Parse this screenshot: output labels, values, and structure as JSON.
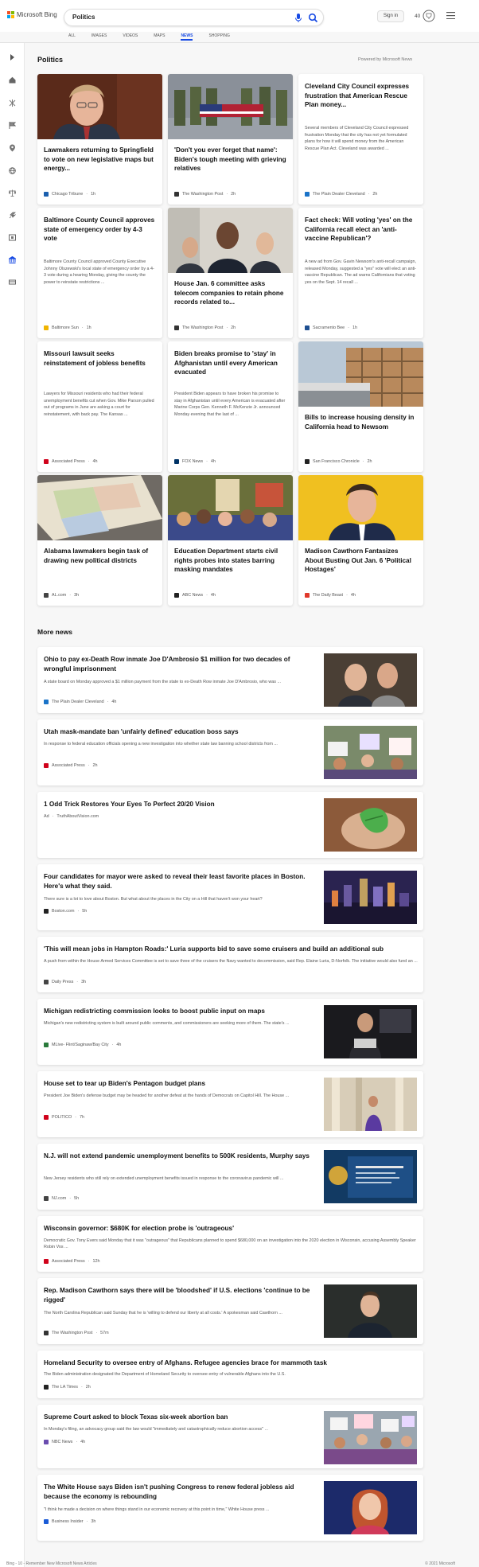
{
  "header": {
    "logo_text": "Microsoft Bing",
    "search_value": "Politics",
    "signin_label": "Sign in",
    "points": "40"
  },
  "tabs": [
    {
      "label": "ALL"
    },
    {
      "label": "IMAGES"
    },
    {
      "label": "VIDEOS"
    },
    {
      "label": "MAPS"
    },
    {
      "label": "NEWS",
      "active": true
    },
    {
      "label": "SHOPPING"
    }
  ],
  "section": {
    "title": "Politics",
    "powered": "Powered by Microsoft News"
  },
  "cards": [
    {
      "title": "Lawmakers returning to Springfield to vote on new legislative maps but energy...",
      "snippet": "",
      "source": "Chicago Tribune",
      "time": "1h",
      "logo_color": "#1b5fae"
    },
    {
      "title": "'Don't you ever forget that name': Biden's tough meeting with grieving relatives",
      "snippet": "",
      "source": "The Washington Post",
      "time": "2h",
      "logo_color": "#333333"
    },
    {
      "title": "Cleveland City Council expresses frustration that American Rescue Plan money...",
      "snippet": "Several members of Cleveland City Council expressed frustration Monday that the city has not yet formulated plans for how it will spend money from the American Rescue Plan Act. Cleveland was awarded ...",
      "source": "The Plain Dealer Cleveland",
      "time": "2h",
      "logo_color": "#1a73c8"
    },
    {
      "title": "Baltimore County Council approves state of emergency order by 4-3 vote",
      "snippet": "Baltimore County Council approved County Executive Johnny Olszewski's local state of emergency order by a 4-3 vote during a hearing Monday, giving the county the power to reinstate restrictions ...",
      "source": "Baltimore Sun",
      "time": "1h",
      "logo_color": "#f0b400"
    },
    {
      "title": "House Jan. 6 committee asks telecom companies to retain phone records related to...",
      "snippet": "",
      "source": "The Washington Post",
      "time": "2h",
      "logo_color": "#333333"
    },
    {
      "title": "Fact check: Will voting 'yes' on the California recall elect an 'anti-vaccine Republican'?",
      "snippet": "A new ad from Gov. Gavin Newsom's anti-recall campaign, released Monday, suggested a \"yes\" vote will elect an anti-vaccine Republican. The ad warns Californians that voting yes on the Sept. 14 recall ...",
      "source": "Sacramento Bee",
      "time": "1h",
      "logo_color": "#1e4f91"
    },
    {
      "title": "Missouri lawsuit seeks reinstatement of jobless benefits",
      "snippet": "Lawyers for Missouri residents who had their federal unemployment benefits cut when Gov. Mike Parson pulled out of programs in June are asking a court for reinstatement, with back pay. The Kansas ...",
      "source": "Associated Press",
      "time": "4h",
      "logo_color": "#d0021b"
    },
    {
      "title": "Biden breaks promise to 'stay' in Afghanistan until every American evacuated",
      "snippet": "President Biden appears to have broken his promise to stay in Afghanistan until every American is evacuated after Marine Corps Gen. Kenneth F. McKenzie Jr. announced Monday evening that the last of ...",
      "source": "FOX News",
      "time": "4h",
      "logo_color": "#003366"
    },
    {
      "title": "Bills to increase housing density in California head to Newsom",
      "snippet": "",
      "source": "San Francisco Chronicle",
      "time": "2h",
      "logo_color": "#222222"
    },
    {
      "title": "Alabama lawmakers begin task of drawing new political districts",
      "snippet": "",
      "source": "AL.com",
      "time": "3h",
      "logo_color": "#444444"
    },
    {
      "title": "Education Department starts civil rights probes into states barring masking mandates",
      "snippet": "",
      "source": "ABC News",
      "time": "4h",
      "logo_color": "#222222"
    },
    {
      "title": "Madison Cawthorn Fantasizes About Busting Out Jan. 6 'Political Hostages'",
      "snippet": "",
      "source": "The Daily Beast",
      "time": "4h",
      "logo_color": "#e0392b"
    }
  ],
  "more": {
    "title": "More news",
    "items": [
      {
        "title": "Ohio to pay ex-Death Row inmate Joe D'Ambrosio $1 million for two decades of wrongful imprisonment",
        "snippet": "A state board on Monday approved a $1 million payment from the state to ex-Death Row inmate Joe D'Ambrosio, who was ...",
        "source": "The Plain Dealer Cleveland",
        "time": "4h",
        "logo_color": "#1a73c8"
      },
      {
        "title": "Utah mask-mandate ban 'unfairly defined' education boss says",
        "snippet": "In response to federal education officials opening a new investigation into whether state law banning school districts from ...",
        "source": "Associated Press",
        "time": "2h",
        "logo_color": "#d0021b"
      },
      {
        "title": "1 Odd Trick Restores Your Eyes To Perfect 20/20 Vision",
        "snippet": "",
        "source": "TruthAboutVision.com",
        "time": "",
        "ad": "Ad",
        "logo_color": ""
      },
      {
        "title": "Four candidates for mayor were asked to reveal their least favorite places in Boston. Here's what they said.",
        "snippet": "There sure is a lot to love about Boston. But what about the places in the City on a Hill that haven't won your heart?",
        "source": "Boston.com",
        "time": "5h",
        "logo_color": "#222222"
      },
      {
        "title": "'This will mean jobs in Hampton Roads:' Luria supports bid to save some cruisers and build an additional sub",
        "snippet": "A push from within the House Armed Services Committee is set to save three of the cruisers the Navy wanted to decommission, said Rep. Elaine Luria, D-Norfolk. The initiative would also fund an ...",
        "source": "Daily Press",
        "time": "3h",
        "logo_color": "#444444"
      },
      {
        "title": "Michigan redistricting commission looks to boost public input on maps",
        "snippet": "Michigan's new redistricting system is built around public comments, and commissioners are seeking more of them. The state's ...",
        "source": "MLive- Flint/Saginaw/Bay City",
        "time": "4h",
        "logo_color": "#2a7a3b"
      },
      {
        "title": "House set to tear up Biden's Pentagon budget plans",
        "snippet": "President Joe Biden's defense budget may be headed for another defeat at the hands of Democrats on Capitol Hill. The House ...",
        "source": "POLITICO",
        "time": "7h",
        "logo_color": "#d0021b"
      },
      {
        "title": "N.J. will not extend pandemic unemployment benefits to 500K residents, Murphy says",
        "snippet": "New Jersey residents who still rely on extended unemployment benefits issued in response to the coronavirus pandemic will ...",
        "source": "NJ.com",
        "time": "5h",
        "logo_color": "#444444"
      },
      {
        "title": "Wisconsin governor: $680K for election probe is 'outrageous'",
        "snippet": "Democratic Gov. Tony Evers said Monday that it was \"outrageous\" that Republicans planned to spend $680,000 on an investigation into the 2020 election in Wisconsin, accusing Assembly Speaker Robin Vos ...",
        "source": "Associated Press",
        "time": "12h",
        "logo_color": "#d0021b"
      },
      {
        "title": "Rep. Madison Cawthorn says there will be 'bloodshed' if U.S. elections 'continue to be rigged'",
        "snippet": "The North Carolina Republican said Sunday that he is 'willing to defend our liberty at all costs.' A spokesman said Cawthorn ...",
        "source": "The Washington Post",
        "time": "57m",
        "logo_color": "#333333"
      },
      {
        "title": "Homeland Security to oversee entry of Afghans. Refugee agencies brace for mammoth task",
        "snippet": "The Biden administration designated the Department of Homeland Security to oversee entry of vulnerable Afghans into the U.S.",
        "source": "The LA Times",
        "time": "2h",
        "logo_color": "#222222"
      },
      {
        "title": "Supreme Court asked to block Texas six-week abortion ban",
        "snippet": "In Monday's filing, an advocacy group said the law would \"immediately and catastrophically reduce abortion access\" ...",
        "source": "NBC News",
        "time": "4h",
        "logo_color": "#6a4caf"
      },
      {
        "title": "The White House says Biden isn't pushing Congress to renew federal jobless aid because the economy is rebounding",
        "snippet": "\"I think he made a decision on where things stand in our economic recovery at this point in time,\" White House press ...",
        "source": "Business Insider",
        "time": "3h",
        "logo_color": "#1a5bd6"
      }
    ]
  },
  "footer": {
    "left": "Bing - 10 - Remember New Microsoft News Articles",
    "right": "© 2021 Microsoft"
  },
  "colors": {
    "accent": "#174ae4",
    "page_bg": "#f7f7f7"
  }
}
